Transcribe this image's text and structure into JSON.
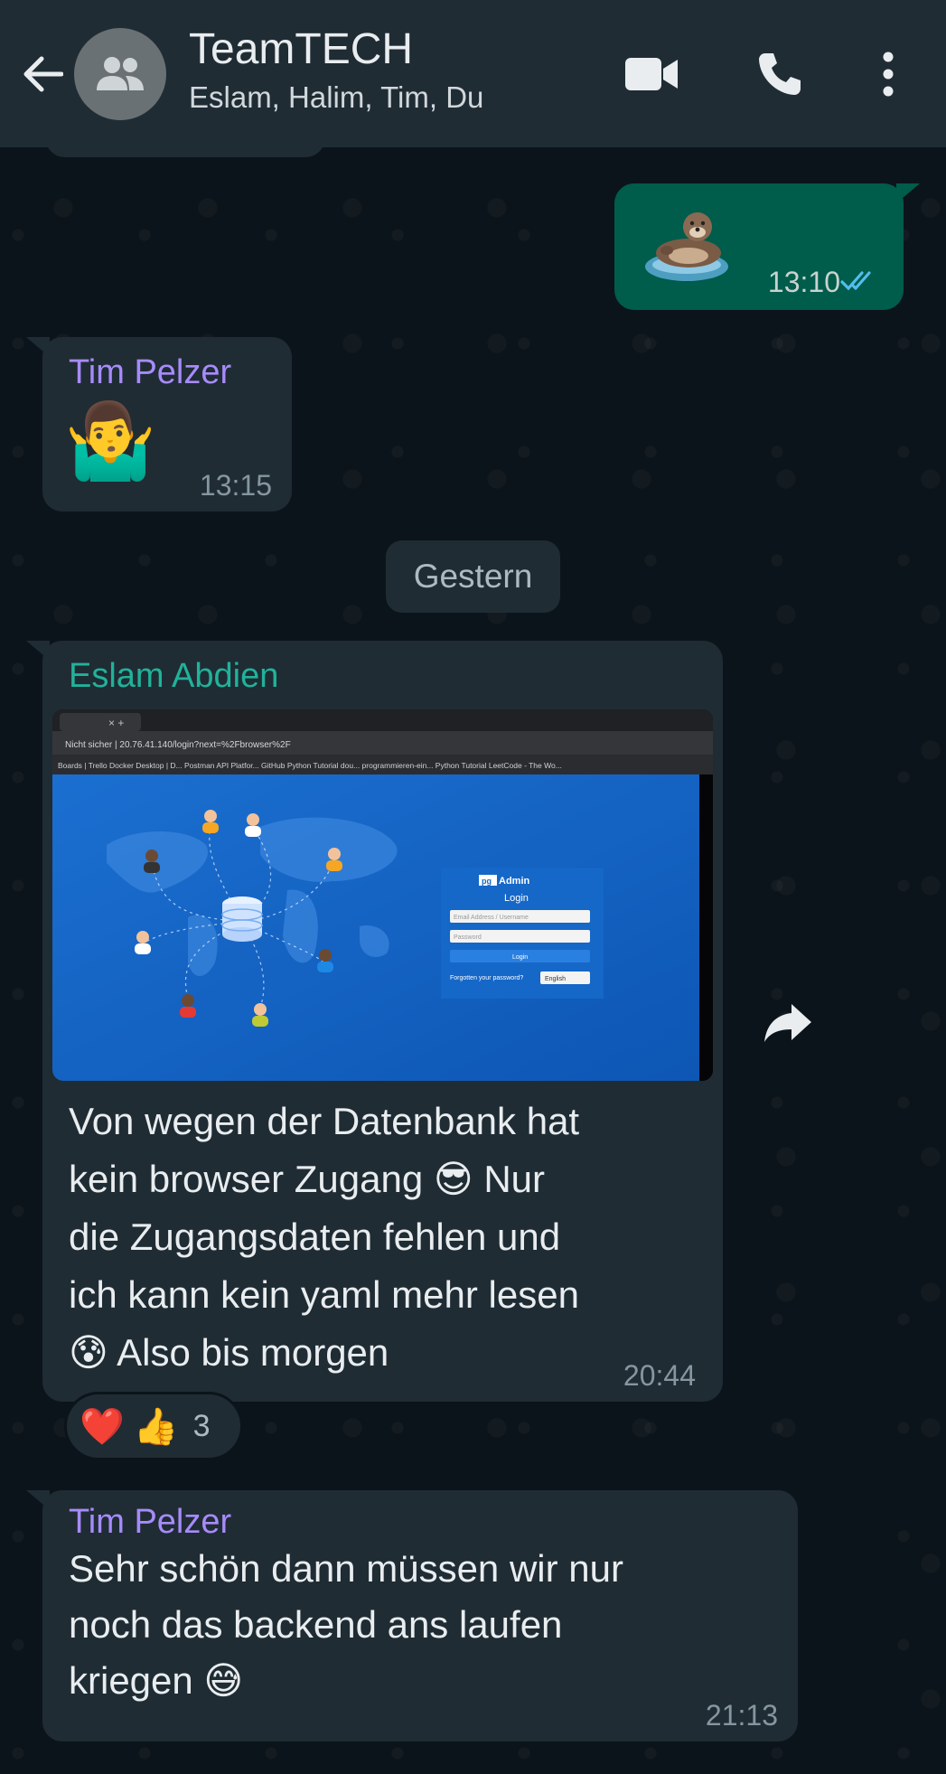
{
  "header": {
    "title": "TeamTECH",
    "subtitle": "Eslam, Halim, Tim, Du"
  },
  "messages": [
    {
      "id": "m1",
      "direction": "out",
      "content": "sticker",
      "sticker": "otter-floating",
      "time": "13:10",
      "status": "read"
    },
    {
      "id": "m2",
      "direction": "in",
      "sender": "Tim Pelzer",
      "sender_color": "#a78bfa",
      "content": "emoji",
      "emoji": "🤷‍♂️",
      "time": "13:15"
    },
    {
      "id": "m3",
      "direction": "in",
      "sender": "Eslam Abdien",
      "sender_color": "#21b29a",
      "content": "image+text",
      "text_lines": [
        "Von wegen der Datenbank hat",
        "kein browser Zugang 😎 Nur",
        "die Zugangsdaten fehlen und",
        "ich kann kein yaml mehr lesen",
        "😰 Also bis morgen"
      ],
      "time": "20:44",
      "reactions": {
        "emojis": [
          "❤️",
          "👍"
        ],
        "count": "3"
      }
    },
    {
      "id": "m4",
      "direction": "in",
      "sender": "Tim Pelzer",
      "sender_color": "#a78bfa",
      "content": "text",
      "text_lines": [
        "Sehr schön dann müssen wir nur",
        "noch das backend ans laufen",
        "kriegen 😅"
      ],
      "time": "21:13"
    }
  ],
  "date_separator": "Gestern",
  "embedded_screenshot": {
    "browser_address": "Nicht sicher | 20.76.41.140/login?next=%2Fbrowser%2F",
    "bookmarks": [
      "Boards | Trello",
      "Docker Desktop | D...",
      "Postman API Platfor...",
      "GitHub",
      "Python Tutorial dou...",
      "programmieren-ein...",
      "Python Tutorial",
      "LeetCode - The Wo..."
    ],
    "pgadmin": {
      "brand": "pgAdmin",
      "heading": "Login",
      "email_placeholder": "Email Address / Username",
      "password_placeholder": "Password",
      "login_button": "Login",
      "forgot": "Forgotten your password?",
      "language": "English"
    }
  },
  "colors": {
    "header_bg": "#1f2c34",
    "chat_bg": "#0b141a",
    "incoming_bubble": "#1f2c34",
    "outgoing_bubble": "#005c4b",
    "read_ticks": "#53bdeb",
    "pgadmin_blue": "#1a6bc9"
  },
  "icons": [
    "back-arrow-icon",
    "group-avatar-icon",
    "video-call-icon",
    "phone-icon",
    "more-vert-icon",
    "double-check-icon",
    "forward-icon"
  ]
}
